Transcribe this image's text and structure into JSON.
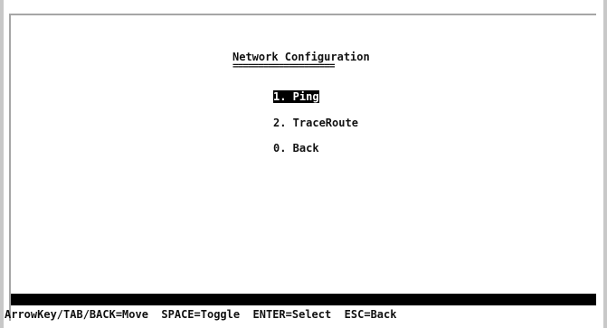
{
  "screen": {
    "title": "Network Configuration",
    "title_underline": "===================="
  },
  "menu": {
    "items": [
      {
        "label": "1. Ping",
        "selected": true
      },
      {
        "label": "2. TraceRoute",
        "selected": false
      },
      {
        "label": "0. Back",
        "selected": false
      }
    ]
  },
  "statusbar": {
    "help_text": "ArrowKey/TAB/BACK=Move  SPACE=Toggle  ENTER=Select  ESC=Back"
  },
  "colors": {
    "background": "#ffffff",
    "text": "#111111",
    "highlight_bg": "#000000",
    "highlight_fg": "#ffffff",
    "frame": "#c8c8c8"
  }
}
